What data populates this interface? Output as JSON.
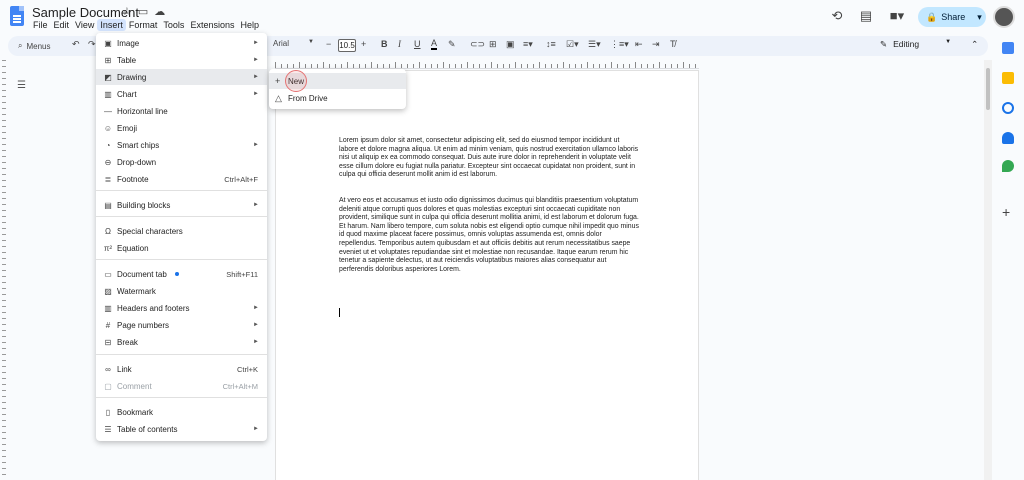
{
  "document": {
    "title": "Sample Document"
  },
  "menubar": [
    "File",
    "Edit",
    "View",
    "Insert",
    "Format",
    "Tools",
    "Extensions",
    "Help"
  ],
  "toolbar": {
    "search_label": "Menus",
    "font": "Arial",
    "font_size": "10.5",
    "mode": "Editing"
  },
  "header": {
    "share_label": "Share"
  },
  "insert_menu": {
    "items": [
      {
        "label": "Image",
        "icon": "image-icon",
        "submenu": true
      },
      {
        "label": "Table",
        "icon": "table-icon",
        "submenu": true
      },
      {
        "label": "Drawing",
        "icon": "drawing-icon",
        "submenu": true,
        "highlighted": true
      },
      {
        "label": "Chart",
        "icon": "chart-icon",
        "submenu": true
      },
      {
        "label": "Horizontal line",
        "icon": "horizontal-line-icon"
      },
      {
        "label": "Emoji",
        "icon": "emoji-icon"
      },
      {
        "label": "Smart chips",
        "icon": "smart-chips-icon",
        "submenu": true
      },
      {
        "label": "Drop-down",
        "icon": "dropdown-icon"
      },
      {
        "label": "Footnote",
        "icon": "footnote-icon",
        "shortcut": "Ctrl+Alt+F"
      },
      {
        "label": "Building blocks",
        "icon": "building-blocks-icon",
        "submenu": true
      },
      {
        "label": "Special characters",
        "icon": "omega-icon"
      },
      {
        "label": "Equation",
        "icon": "pi-icon"
      },
      {
        "label": "Document tab",
        "icon": "document-tab-icon",
        "shortcut": "Shift+F11"
      },
      {
        "label": "Watermark",
        "icon": "watermark-icon"
      },
      {
        "label": "Headers and footers",
        "icon": "headers-footers-icon",
        "submenu": true
      },
      {
        "label": "Page numbers",
        "icon": "hash-icon",
        "submenu": true
      },
      {
        "label": "Break",
        "icon": "break-icon",
        "submenu": true
      },
      {
        "label": "Link",
        "icon": "link-icon",
        "shortcut": "Ctrl+K"
      },
      {
        "label": "Comment",
        "icon": "comment-icon",
        "shortcut": "Ctrl+Alt+M",
        "disabled": true
      },
      {
        "label": "Bookmark",
        "icon": "bookmark-icon"
      },
      {
        "label": "Table of contents",
        "icon": "toc-icon",
        "submenu": true
      }
    ]
  },
  "drawing_submenu": {
    "items": [
      {
        "label": "New",
        "icon": "plus-icon",
        "highlighted": true
      },
      {
        "label": "From Drive",
        "icon": "drive-icon"
      }
    ]
  },
  "body_text": {
    "p1": "Lorem ipsum dolor sit amet, consectetur adipiscing elit, sed do eiusmod tempor incididunt ut labore et dolore magna aliqua. Ut enim ad minim veniam, quis nostrud exercitation ullamco laboris nisi ut aliquip ex ea commodo consequat. Duis aute irure dolor in reprehenderit in voluptate velit esse cillum dolore eu fugiat nulla pariatur. Excepteur sint occaecat cupidatat non proident, sunt in culpa qui officia deserunt mollit anim id est laborum.",
    "p2": "At vero eos et accusamus et iusto odio dignissimos ducimus qui blanditiis praesentium voluptatum deleniti atque corrupti quos dolores et quas molestias excepturi sint occaecati cupiditate non provident, similique sunt in culpa qui officia deserunt mollitia animi, id est laborum et dolorum fuga. Et harum. Nam libero tempore, cum soluta nobis est eligendi optio cumque nihil impedit quo minus id quod maxime placeat facere possimus, omnis voluptas assumenda est, omnis dolor repellendus. Temporibus autem quibusdam et aut officiis debitis aut rerum necessitatibus saepe eveniet ut et voluptates repudiandae sint et molestiae non recusandae. Itaque earum rerum hic tenetur a sapiente delectus, ut aut reiciendis voluptatibus maiores alias consequatur aut perferendis doloribus asperiores Lorem."
  },
  "colors": {
    "accent": "#1a73e8",
    "share_bg": "#c2e7ff",
    "menu_highlight": "#e8eaed"
  }
}
